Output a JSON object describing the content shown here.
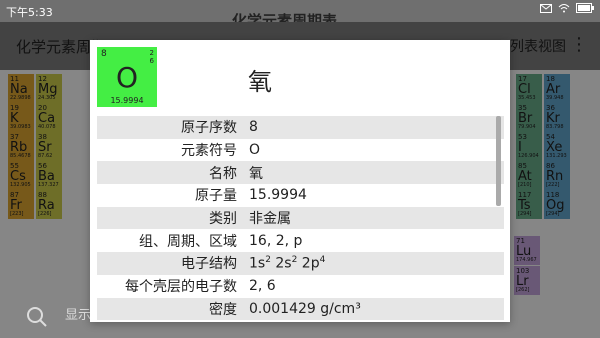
{
  "status": {
    "time": "下午5:33",
    "title_peek": "化学元素周期表"
  },
  "appbar": {
    "title": "化学元素周期",
    "view": "列表视图",
    "menu": "⋮"
  },
  "background": {
    "tiles": [
      {
        "n": "11",
        "s": "Na",
        "m": "22.9898",
        "c": "#d9a330"
      },
      {
        "n": "12",
        "s": "Mg",
        "m": "24.305",
        "c": "#c8c84a"
      },
      {
        "n": "19",
        "s": "K",
        "m": "39.0983",
        "c": "#d9a330"
      },
      {
        "n": "20",
        "s": "Ca",
        "m": "40.078",
        "c": "#c8c84a"
      },
      {
        "n": "37",
        "s": "Rb",
        "m": "85.4678",
        "c": "#d9a330"
      },
      {
        "n": "38",
        "s": "Sr",
        "m": "87.62",
        "c": "#c8c84a"
      },
      {
        "n": "55",
        "s": "Cs",
        "m": "132.905",
        "c": "#d9a330"
      },
      {
        "n": "56",
        "s": "Ba",
        "m": "137.327",
        "c": "#c8c84a"
      },
      {
        "n": "87",
        "s": "Fr",
        "m": "[223]",
        "c": "#d9a330"
      },
      {
        "n": "88",
        "s": "Ra",
        "m": "[226]",
        "c": "#c8c84a"
      },
      {
        "n": "17",
        "s": "Cl",
        "m": "35.453",
        "c": "#66aa88"
      },
      {
        "n": "18",
        "s": "Ar",
        "m": "39.948",
        "c": "#5fa3c8"
      },
      {
        "n": "35",
        "s": "Br",
        "m": "79.904",
        "c": "#66aa88"
      },
      {
        "n": "36",
        "s": "Kr",
        "m": "83.798",
        "c": "#5fa3c8"
      },
      {
        "n": "53",
        "s": "I",
        "m": "126.904",
        "c": "#66aa88"
      },
      {
        "n": "54",
        "s": "Xe",
        "m": "131.293",
        "c": "#5fa3c8"
      },
      {
        "n": "85",
        "s": "At",
        "m": "[210]",
        "c": "#66aa88"
      },
      {
        "n": "86",
        "s": "Rn",
        "m": "[222]",
        "c": "#5fa3c8"
      },
      {
        "n": "117",
        "s": "Ts",
        "m": "[294]",
        "c": "#66aa88"
      },
      {
        "n": "118",
        "s": "Og",
        "m": "[294]",
        "c": "#5fa3c8"
      },
      {
        "n": "71",
        "s": "Lu",
        "m": "174.967",
        "c": "#c0a0d8"
      },
      {
        "n": "103",
        "s": "Lr",
        "m": "[262]",
        "c": "#c0a0d8"
      }
    ],
    "search_label": "显示"
  },
  "element": {
    "number": "8",
    "symbol": "O",
    "mass": "15.9994",
    "shells_1": "2",
    "shells_2": "6",
    "name": "氧",
    "badge_color": "#44ee44"
  },
  "properties": [
    {
      "label": "原子序数",
      "value": "8"
    },
    {
      "label": "元素符号",
      "value": "O"
    },
    {
      "label": "名称",
      "value": "氧"
    },
    {
      "label": "原子量",
      "value": "15.9994"
    },
    {
      "label": "类别",
      "value": "非金属"
    },
    {
      "label": "组、周期、区域",
      "value": "16, 2, p"
    },
    {
      "label": "电子结构",
      "value": ""
    },
    {
      "label": "每个壳层的电子数",
      "value": "2, 6"
    },
    {
      "label": "密度",
      "value": "0.001429 g/cm³"
    }
  ],
  "electron_config": [
    {
      "base": "1s",
      "sup": "2"
    },
    {
      "base": "2s",
      "sup": "2"
    },
    {
      "base": "2p",
      "sup": "4"
    }
  ]
}
